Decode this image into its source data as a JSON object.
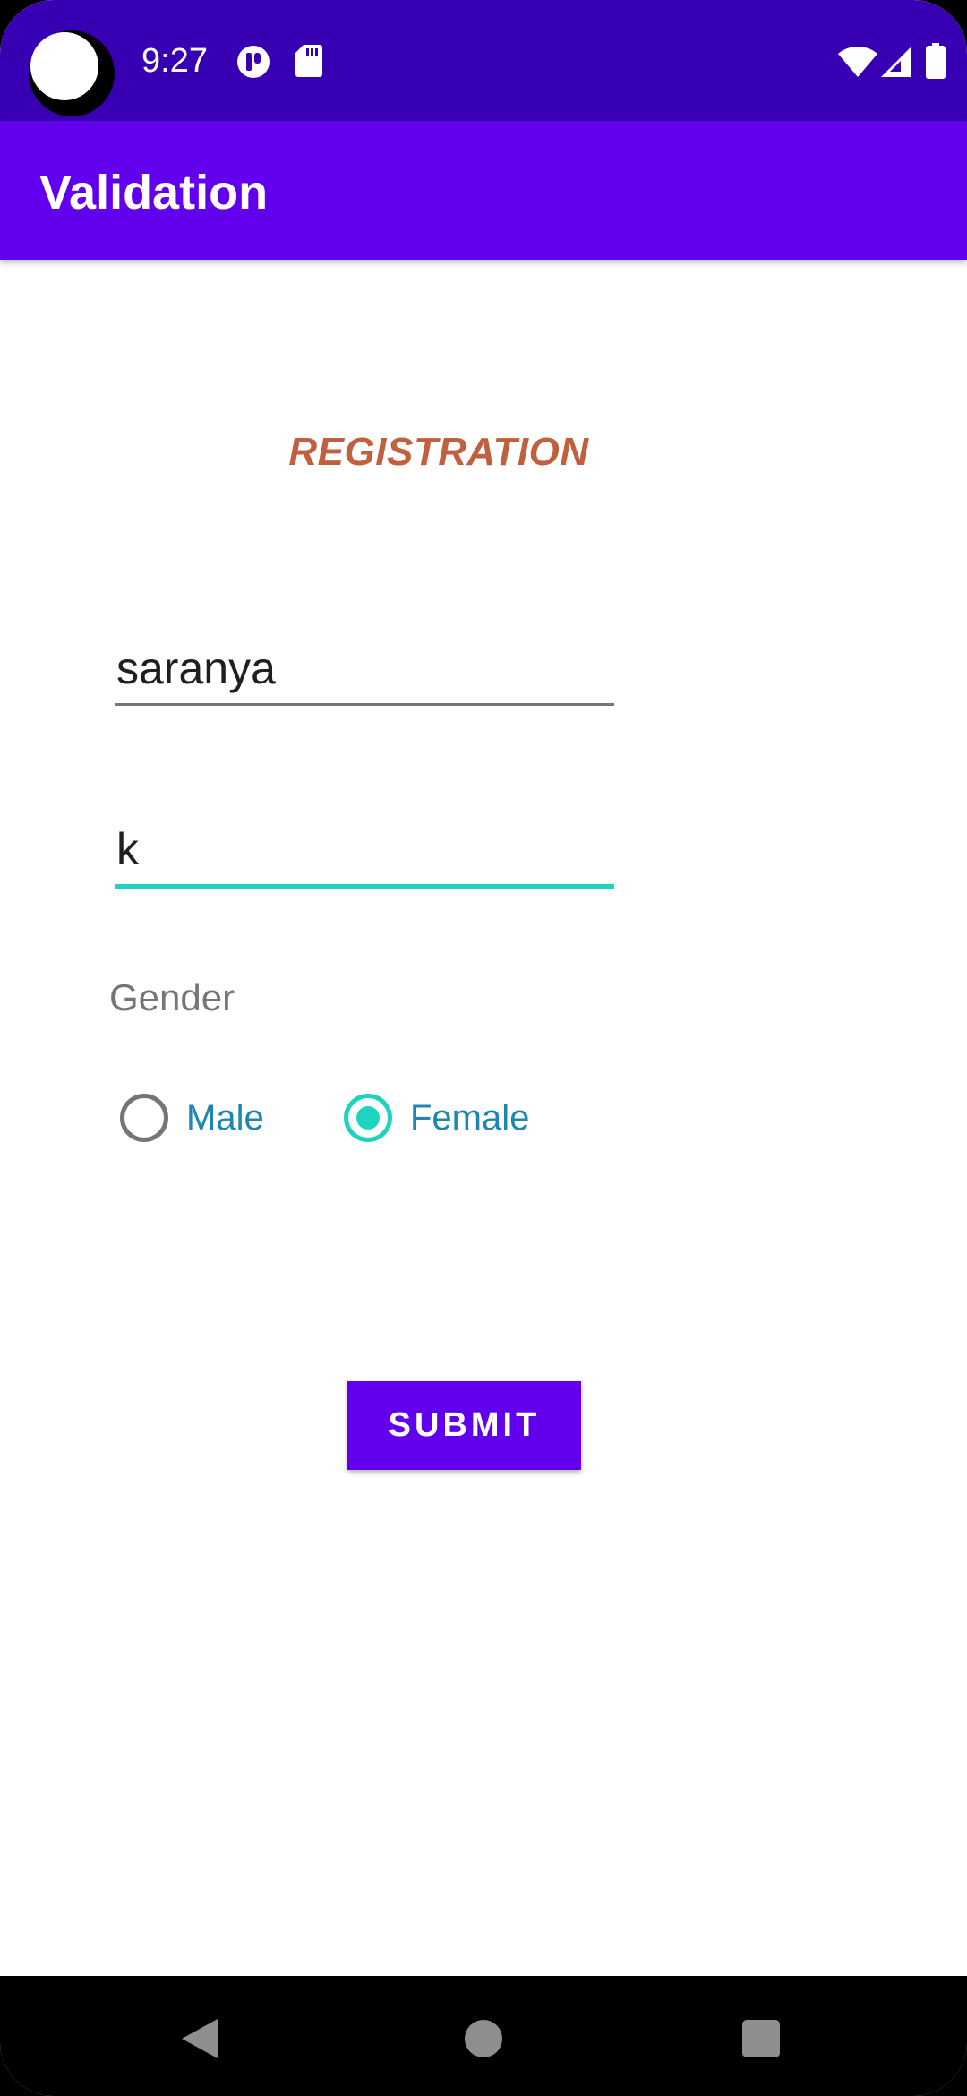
{
  "status_bar": {
    "time": "9:27",
    "icons": [
      "camera-cutout",
      "signal-app-icon",
      "sd-card-icon",
      "wifi-icon",
      "cellular-icon",
      "battery-icon"
    ]
  },
  "app_bar": {
    "title": "Validation"
  },
  "form": {
    "heading": "REGISTRATION",
    "first_name_value": "saranya",
    "last_name_value": "k",
    "gender_label": "Gender",
    "gender_options": [
      {
        "label": "Male",
        "checked": false
      },
      {
        "label": "Female",
        "checked": true
      }
    ],
    "submit_label": "SUBMIT"
  },
  "colors": {
    "status_bar": "#3700b3",
    "primary": "#6200ee",
    "accent": "#1ed4c0",
    "heading": "#c0603e",
    "radio_label": "#1f86b0"
  },
  "nav_bar": {
    "icons": [
      "back-icon",
      "home-icon",
      "recents-icon"
    ]
  }
}
